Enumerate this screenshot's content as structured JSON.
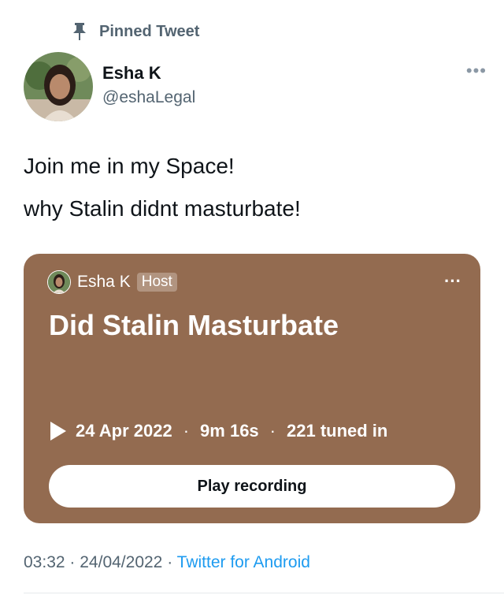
{
  "pinned": {
    "label": "Pinned Tweet",
    "icon": "pin-icon"
  },
  "author": {
    "name": "Esha K",
    "handle": "@eshaLegal"
  },
  "tweet": {
    "line1": "Join me in my Space!",
    "line2": "why Stalin didnt masturbate!"
  },
  "space": {
    "host_name": "Esha K",
    "host_badge": "Host",
    "title": "Did Stalin Masturbate",
    "date": "24 Apr 2022",
    "duration": "9m 16s",
    "tuned_in": "221 tuned in",
    "separator": "·",
    "play_label": "Play recording",
    "card_color": "#936b50"
  },
  "footer": {
    "time": "03:32",
    "separator": "·",
    "date": "24/04/2022",
    "source": "Twitter for Android",
    "link_color": "#1d9bf0"
  }
}
